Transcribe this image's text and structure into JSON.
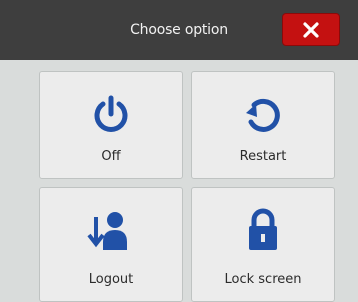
{
  "dialog": {
    "title": "Choose option",
    "close_icon": "close-icon",
    "accent_color": "#c41111",
    "options": [
      {
        "label": "Off",
        "icon": "power-icon"
      },
      {
        "label": "Restart",
        "icon": "restart-icon"
      },
      {
        "label": "Logout",
        "icon": "logout-icon"
      },
      {
        "label": "Lock screen",
        "icon": "lock-icon"
      }
    ]
  }
}
